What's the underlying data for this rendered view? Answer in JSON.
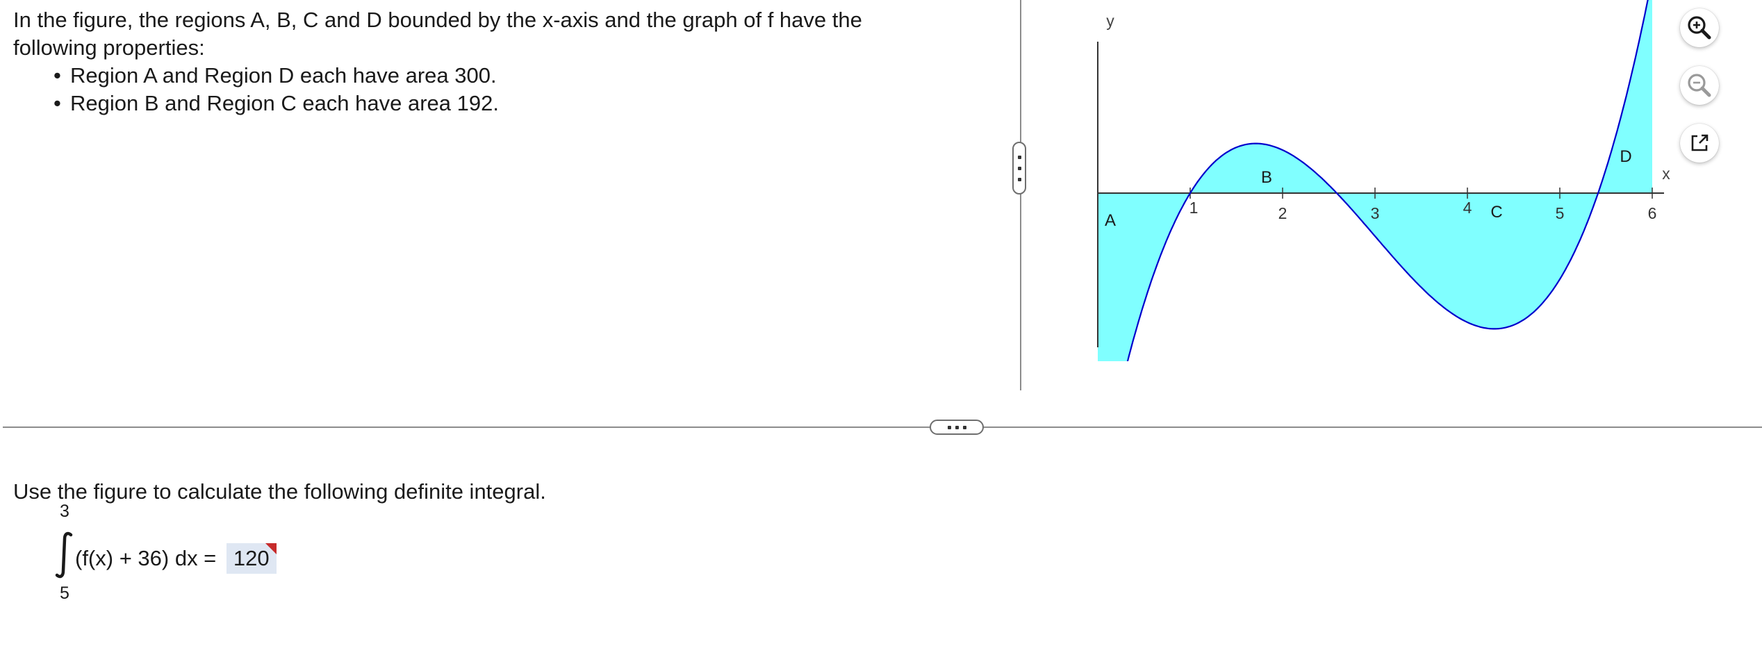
{
  "problem": {
    "intro_line1": "In the figure, the regions A, B, C and D bounded by the x-axis and the graph of f have the",
    "intro_line2": "following properties:",
    "bullets": [
      "Region A and Region D each have area 300.",
      "Region B and Region C each have area 192."
    ],
    "bullet_glyph": "•"
  },
  "figure": {
    "y_label": "y",
    "x_label": "x",
    "x_ticks": [
      "1",
      "2",
      "3",
      "4",
      "5",
      "6"
    ],
    "regions": {
      "a": "A",
      "b": "B",
      "c": "C",
      "d": "D"
    },
    "fill_color": "#80ffff",
    "curve_color": "#0000cc"
  },
  "tools": {
    "zoom_in_icon": "zoom-in-icon",
    "zoom_out_icon": "zoom-out-icon",
    "popout_icon": "popout-icon"
  },
  "question": {
    "text": "Use the figure to calculate the following definite integral.",
    "upper_limit": "3",
    "lower_limit": "5",
    "integrand": "(f(x) + 36) dx =",
    "answer": "120"
  }
}
